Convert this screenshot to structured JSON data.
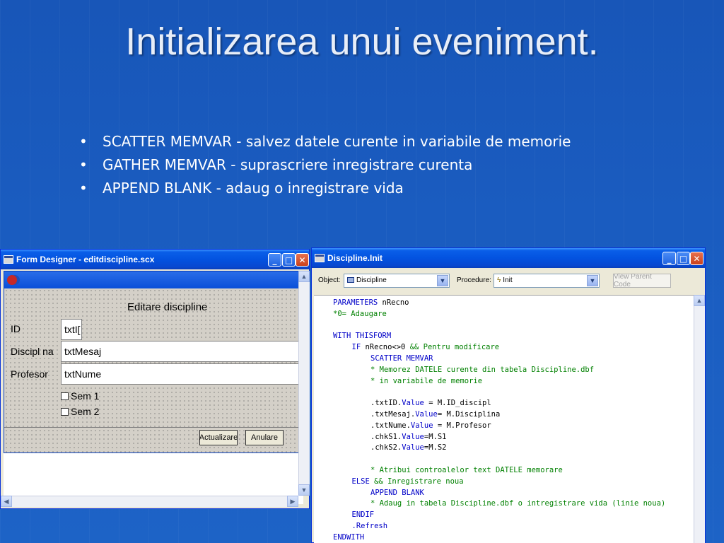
{
  "slide": {
    "title": "Initializarea unui eveniment.",
    "bullets": [
      "SCATTER MEMVAR - salvez datele curente in variabile de memorie",
      "GATHER MEMVAR - suprascriere inregistrare curenta",
      "APPEND BLANK  - adaug o inregistrare vida"
    ],
    "bullet_glyph": "•"
  },
  "form_designer": {
    "title": "Form Designer - editdiscipline.scx",
    "form_caption": "Editare discipline",
    "labels": [
      "ID",
      "Discipl na",
      "Profesor"
    ],
    "textboxes": [
      "txtI[",
      "txtMesaj",
      "txtNume"
    ],
    "checkboxes": [
      "Sem 1",
      "Sem 2"
    ],
    "buttons": {
      "update": "Actualizare",
      "cancel": "Anulare"
    }
  },
  "code_window": {
    "title": "Discipline.Init",
    "object_label": "Object:",
    "object_value": "Discipline",
    "procedure_label": "Procedure:",
    "procedure_value": "Init",
    "view_parent_code": "View Parent Code",
    "code_lines": [
      {
        "indent": 0,
        "segments": [
          {
            "t": "PARAMETERS",
            "c": "blue"
          },
          {
            "t": " nRecno",
            "c": "black"
          }
        ]
      },
      {
        "indent": 0,
        "segments": [
          {
            "t": "*0= Adaugare",
            "c": "green"
          }
        ]
      },
      {
        "indent": 0,
        "segments": []
      },
      {
        "indent": 0,
        "segments": [
          {
            "t": "WITH THISFORM",
            "c": "blue"
          }
        ]
      },
      {
        "indent": 1,
        "segments": [
          {
            "t": "IF",
            "c": "blue"
          },
          {
            "t": " nRecno<>0 ",
            "c": "black"
          },
          {
            "t": "&& Pentru modificare",
            "c": "green"
          }
        ]
      },
      {
        "indent": 2,
        "segments": [
          {
            "t": "SCATTER MEMVAR",
            "c": "blue"
          }
        ]
      },
      {
        "indent": 2,
        "segments": [
          {
            "t": "* Memorez DATELE curente din tabela Discipline.dbf",
            "c": "green"
          }
        ]
      },
      {
        "indent": 2,
        "segments": [
          {
            "t": "* in variabile de memorie",
            "c": "green"
          }
        ]
      },
      {
        "indent": 0,
        "segments": []
      },
      {
        "indent": 2,
        "segments": [
          {
            "t": ".txtID.",
            "c": "black"
          },
          {
            "t": "Value",
            "c": "blue"
          },
          {
            "t": " = M.ID_discipl",
            "c": "black"
          }
        ]
      },
      {
        "indent": 2,
        "segments": [
          {
            "t": ".txtMesaj.",
            "c": "black"
          },
          {
            "t": "Value",
            "c": "blue"
          },
          {
            "t": "= M.Disciplina",
            "c": "black"
          }
        ]
      },
      {
        "indent": 2,
        "segments": [
          {
            "t": ".txtNume.",
            "c": "black"
          },
          {
            "t": "Value",
            "c": "blue"
          },
          {
            "t": " = M.Profesor",
            "c": "black"
          }
        ]
      },
      {
        "indent": 2,
        "segments": [
          {
            "t": ".chkS1.",
            "c": "black"
          },
          {
            "t": "Value",
            "c": "blue"
          },
          {
            "t": "=M.S1",
            "c": "black"
          }
        ]
      },
      {
        "indent": 2,
        "segments": [
          {
            "t": ".chkS2.",
            "c": "black"
          },
          {
            "t": "Value",
            "c": "blue"
          },
          {
            "t": "=M.S2",
            "c": "black"
          }
        ]
      },
      {
        "indent": 0,
        "segments": []
      },
      {
        "indent": 2,
        "segments": [
          {
            "t": "* Atribui controalelor text DATELE memorare",
            "c": "green"
          }
        ]
      },
      {
        "indent": 1,
        "segments": [
          {
            "t": "ELSE",
            "c": "blue"
          },
          {
            "t": " && Inregistrare noua",
            "c": "green"
          }
        ]
      },
      {
        "indent": 2,
        "segments": [
          {
            "t": "APPEND BLANK",
            "c": "blue"
          }
        ]
      },
      {
        "indent": 2,
        "segments": [
          {
            "t": "* Adaug in tabela Discipline.dbf o intregistrare vida (linie noua)",
            "c": "green"
          }
        ]
      },
      {
        "indent": 1,
        "segments": [
          {
            "t": "ENDIF",
            "c": "blue"
          }
        ]
      },
      {
        "indent": 1,
        "segments": [
          {
            "t": ".Refresh",
            "c": "blue"
          }
        ]
      },
      {
        "indent": 0,
        "segments": [
          {
            "t": "ENDWITH",
            "c": "blue"
          }
        ]
      }
    ]
  },
  "colors": {
    "keyword": "#0000c8",
    "comment": "#008000",
    "slide_background": "#1a5cc0",
    "xp_titlebar": "#0353e0"
  }
}
